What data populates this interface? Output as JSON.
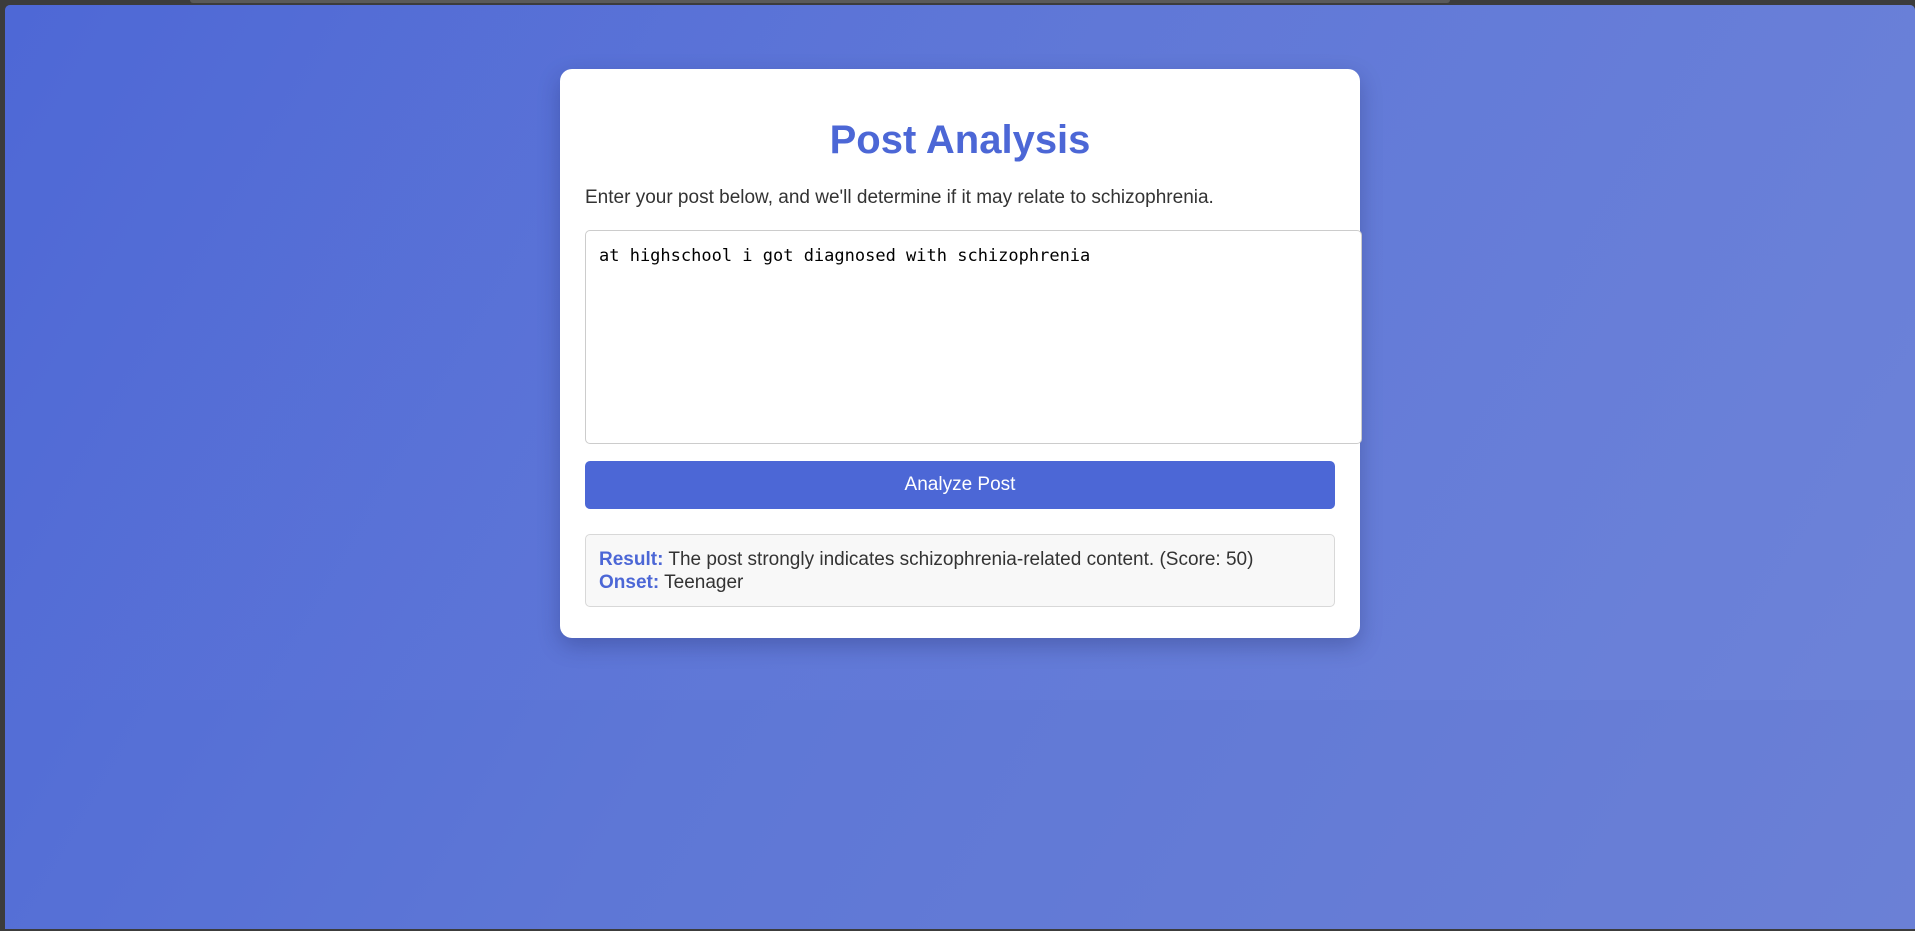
{
  "page": {
    "title": "Post Analysis",
    "subtitle": "Enter your post below, and we'll determine if it may relate to schizophrenia."
  },
  "form": {
    "post_value": "at highschool i got diagnosed with schizophrenia",
    "analyze_label": "Analyze Post"
  },
  "result": {
    "result_label": "Result:",
    "result_text": "The post strongly indicates schizophrenia-related content. (Score: 50)",
    "onset_label": "Onset:",
    "onset_text": "Teenager"
  },
  "colors": {
    "accent": "#4c67d6",
    "background_start": "#4d68d6",
    "background_end": "#6b80d6",
    "card": "#ffffff",
    "result_box": "#f8f8f8"
  }
}
